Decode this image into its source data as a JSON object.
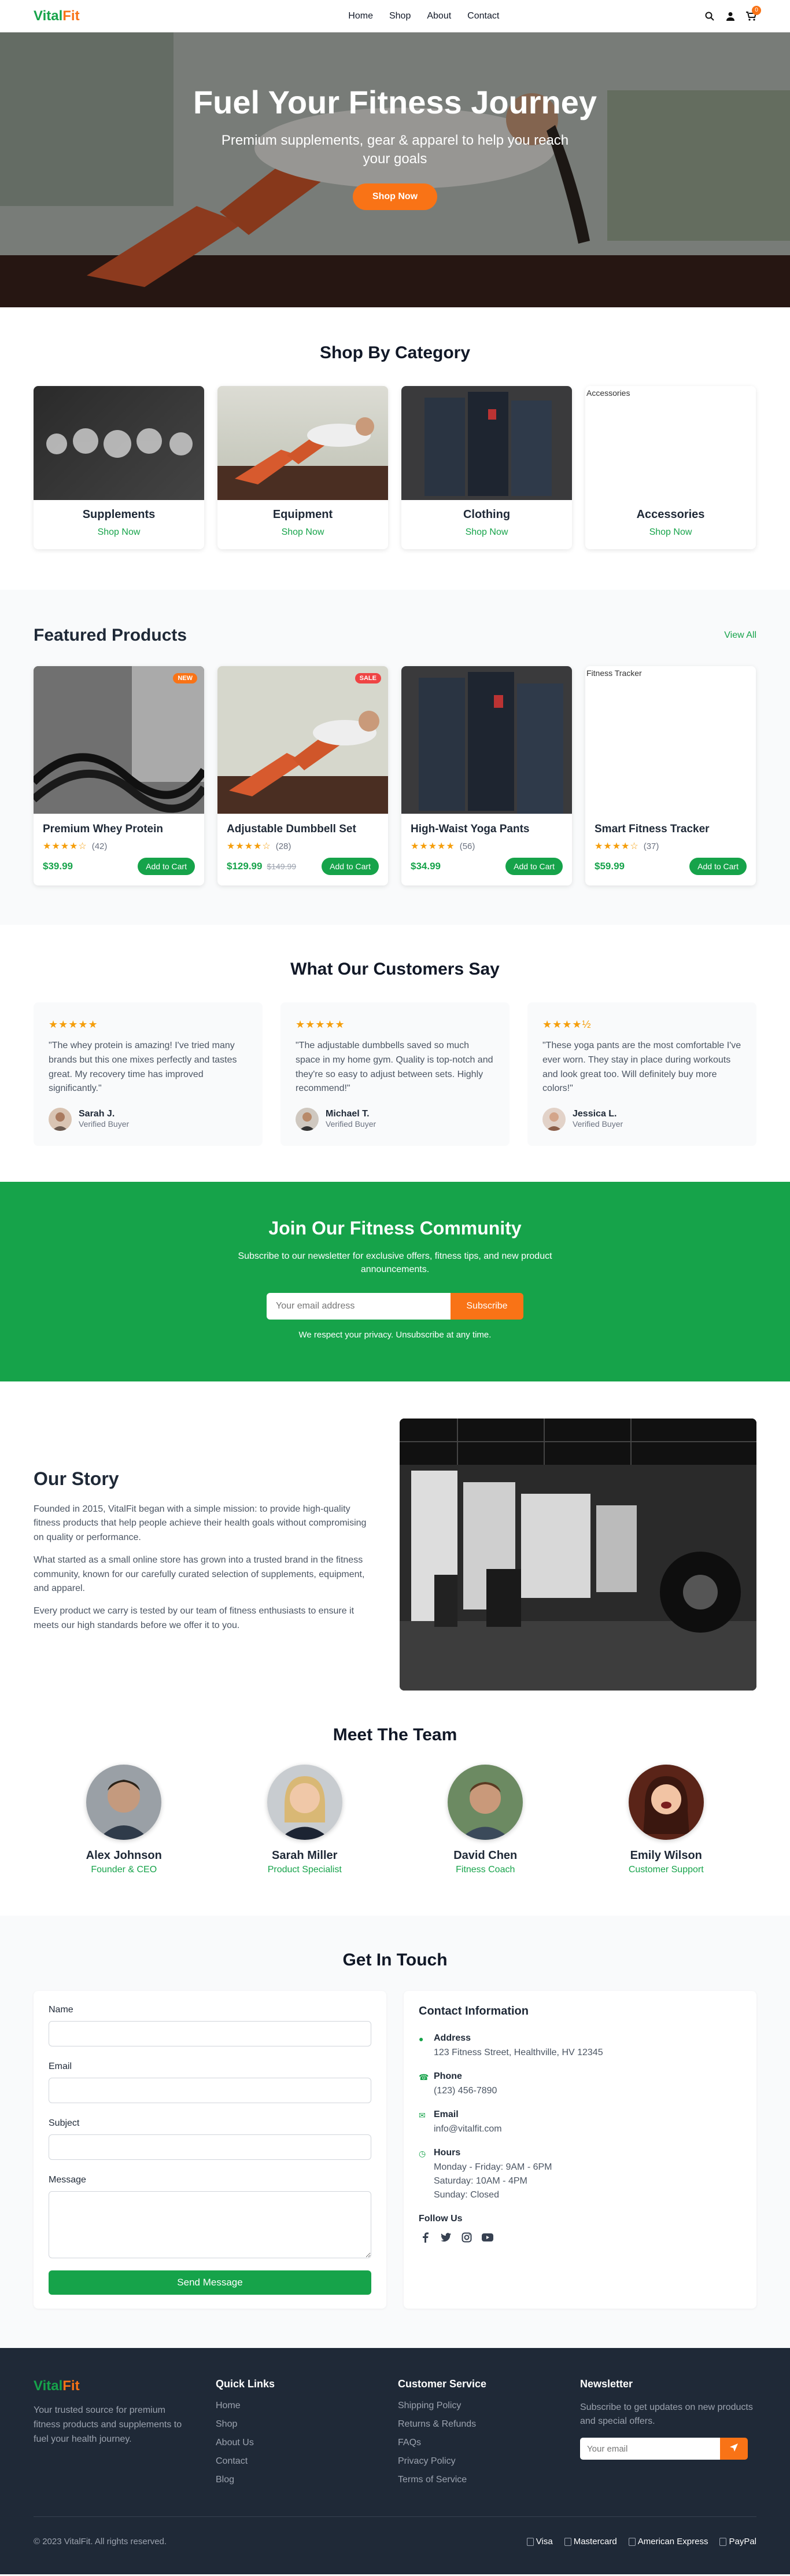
{
  "brand": {
    "part1": "Vital",
    "part2": "Fit"
  },
  "nav": [
    "Home",
    "Shop",
    "About",
    "Contact"
  ],
  "cart_count": "0",
  "hero": {
    "title": "Fuel Your Fitness Journey",
    "subtitle": "Premium supplements, gear & apparel to help you reach your goals",
    "cta": "Shop Now"
  },
  "categories": {
    "title": "Shop By Category",
    "items": [
      {
        "name": "Supplements",
        "link": "Shop Now"
      },
      {
        "name": "Equipment",
        "link": "Shop Now"
      },
      {
        "name": "Clothing",
        "link": "Shop Now"
      },
      {
        "name": "Accessories",
        "link": "Shop Now",
        "alt": "Accessories"
      }
    ]
  },
  "featured": {
    "title": "Featured Products",
    "view_all": "View All",
    "items": [
      {
        "name": "Premium Whey Protein",
        "stars": "★★★★☆",
        "reviews": "(42)",
        "price": "$39.99",
        "old": "",
        "tag": "NEW",
        "button": "Add to Cart"
      },
      {
        "name": "Adjustable Dumbbell Set",
        "stars": "★★★★☆",
        "reviews": "(28)",
        "price": "$129.99",
        "old": "$149.99",
        "tag": "SALE",
        "button": "Add to Cart"
      },
      {
        "name": "High-Waist Yoga Pants",
        "stars": "★★★★★",
        "reviews": "(56)",
        "price": "$34.99",
        "old": "",
        "tag": "",
        "button": "Add to Cart"
      },
      {
        "name": "Smart Fitness Tracker",
        "stars": "★★★★☆",
        "reviews": "(37)",
        "price": "$59.99",
        "old": "",
        "tag": "",
        "button": "Add to Cart",
        "alt": "Fitness Tracker"
      }
    ],
    "colors": {
      "new": "#f97316",
      "sale": "#ef4444"
    }
  },
  "testimonials": {
    "title": "What Our Customers Say",
    "items": [
      {
        "stars": "★★★★★",
        "quote": "\"The whey protein is amazing! I've tried many brands but this one mixes perfectly and tastes great. My recovery time has improved significantly.\"",
        "name": "Sarah J.",
        "role": "Verified Buyer"
      },
      {
        "stars": "★★★★★",
        "quote": "\"The adjustable dumbbells saved so much space in my home gym. Quality is top-notch and they're so easy to adjust between sets. Highly recommend!\"",
        "name": "Michael T.",
        "role": "Verified Buyer"
      },
      {
        "stars": "★★★★½",
        "quote": "\"These yoga pants are the most comfortable I've ever worn. They stay in place during workouts and look great too. Will definitely buy more colors!\"",
        "name": "Jessica L.",
        "role": "Verified Buyer"
      }
    ]
  },
  "newsletter": {
    "title": "Join Our Fitness Community",
    "text": "Subscribe to our newsletter for exclusive offers, fitness tips, and new product announcements.",
    "placeholder": "Your email address",
    "button": "Subscribe",
    "note": "We respect your privacy. Unsubscribe at any time."
  },
  "story": {
    "title": "Our Story",
    "paragraphs": [
      "Founded in 2015, VitalFit began with a simple mission: to provide high-quality fitness products that help people achieve their health goals without compromising on quality or performance.",
      "What started as a small online store has grown into a trusted brand in the fitness community, known for our carefully curated selection of supplements, equipment, and apparel.",
      "Every product we carry is tested by our team of fitness enthusiasts to ensure it meets our high standards before we offer it to you."
    ]
  },
  "team": {
    "title": "Meet The Team",
    "members": [
      {
        "name": "Alex Johnson",
        "role": "Founder & CEO"
      },
      {
        "name": "Sarah Miller",
        "role": "Product Specialist"
      },
      {
        "name": "David Chen",
        "role": "Fitness Coach"
      },
      {
        "name": "Emily Wilson",
        "role": "Customer Support"
      }
    ]
  },
  "contact": {
    "title": "Get In Touch",
    "form": {
      "name": "Name",
      "email": "Email",
      "subject": "Subject",
      "message": "Message",
      "button": "Send Message"
    },
    "info": {
      "title": "Contact Information",
      "address_label": "Address",
      "address": "123 Fitness Street, Healthville, HV 12345",
      "phone_label": "Phone",
      "phone": "(123) 456-7890",
      "email_label": "Email",
      "email": "info@vitalfit.com",
      "hours_label": "Hours",
      "hours": [
        "Monday - Friday: 9AM - 6PM",
        "Saturday: 10AM - 4PM",
        "Sunday: Closed"
      ],
      "follow": "Follow Us"
    }
  },
  "footer": {
    "desc": "Your trusted source for premium fitness products and supplements to fuel your health journey.",
    "quick_title": "Quick Links",
    "quick": [
      "Home",
      "Shop",
      "About Us",
      "Contact",
      "Blog"
    ],
    "service_title": "Customer Service",
    "service": [
      "Shipping Policy",
      "Returns & Refunds",
      "FAQs",
      "Privacy Policy",
      "Terms of Service"
    ],
    "news_title": "Newsletter",
    "news_text": "Subscribe to get updates on new products and special offers.",
    "news_placeholder": "Your email",
    "copyright": "© 2023 VitalFit. All rights reserved.",
    "payments": [
      "Visa",
      "Mastercard",
      "American Express",
      "PayPal"
    ]
  }
}
